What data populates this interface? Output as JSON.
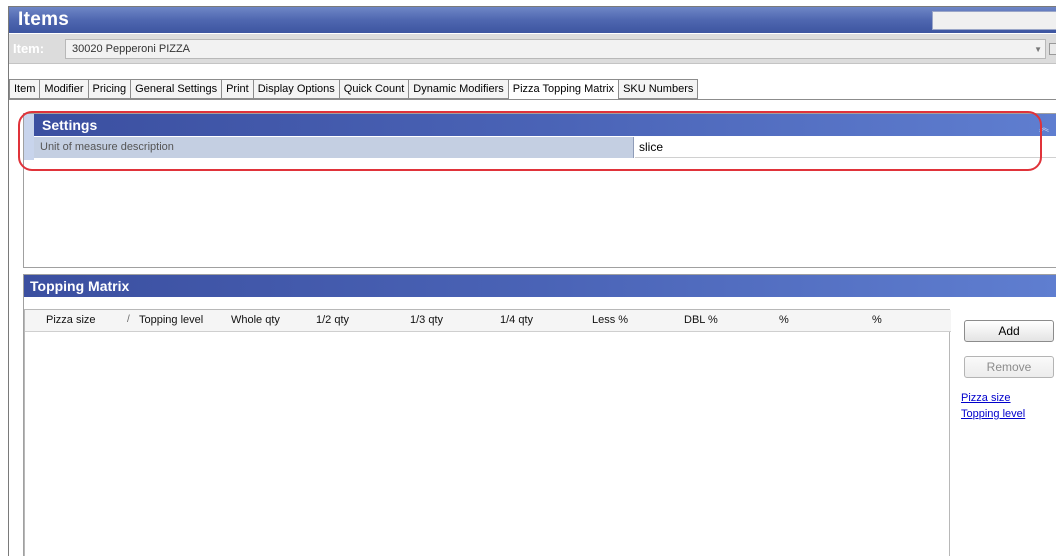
{
  "window": {
    "title": "Items"
  },
  "item_bar": {
    "label": "Item:",
    "selected_value": "30020 Pepperoni PIZZA"
  },
  "tabs": [
    {
      "label": "Item"
    },
    {
      "label": "Modifier"
    },
    {
      "label": "Pricing"
    },
    {
      "label": "General Settings"
    },
    {
      "label": "Print"
    },
    {
      "label": "Display Options"
    },
    {
      "label": "Quick Count"
    },
    {
      "label": "Dynamic Modifiers"
    },
    {
      "label": "Pizza Topping Matrix",
      "active": true
    },
    {
      "label": "SKU Numbers"
    }
  ],
  "settings": {
    "title": "Settings",
    "rows": [
      {
        "label": "Unit of measure description",
        "value": "slice"
      }
    ]
  },
  "topping_matrix": {
    "title": "Topping Matrix",
    "columns": [
      "Pizza size",
      "Topping level",
      "Whole qty",
      "1/2 qty",
      "1/3 qty",
      "1/4 qty",
      "Less %",
      "DBL %",
      "%",
      "%"
    ],
    "sort_indicator": "/",
    "rows": [],
    "buttons": {
      "add": "Add",
      "remove": "Remove"
    },
    "links": {
      "pizza_size": "Pizza size",
      "topping_level": "Topping level"
    }
  },
  "colors": {
    "header_blue": "#4a63b6",
    "highlight": "#e0333a",
    "link": "#0000cc"
  }
}
